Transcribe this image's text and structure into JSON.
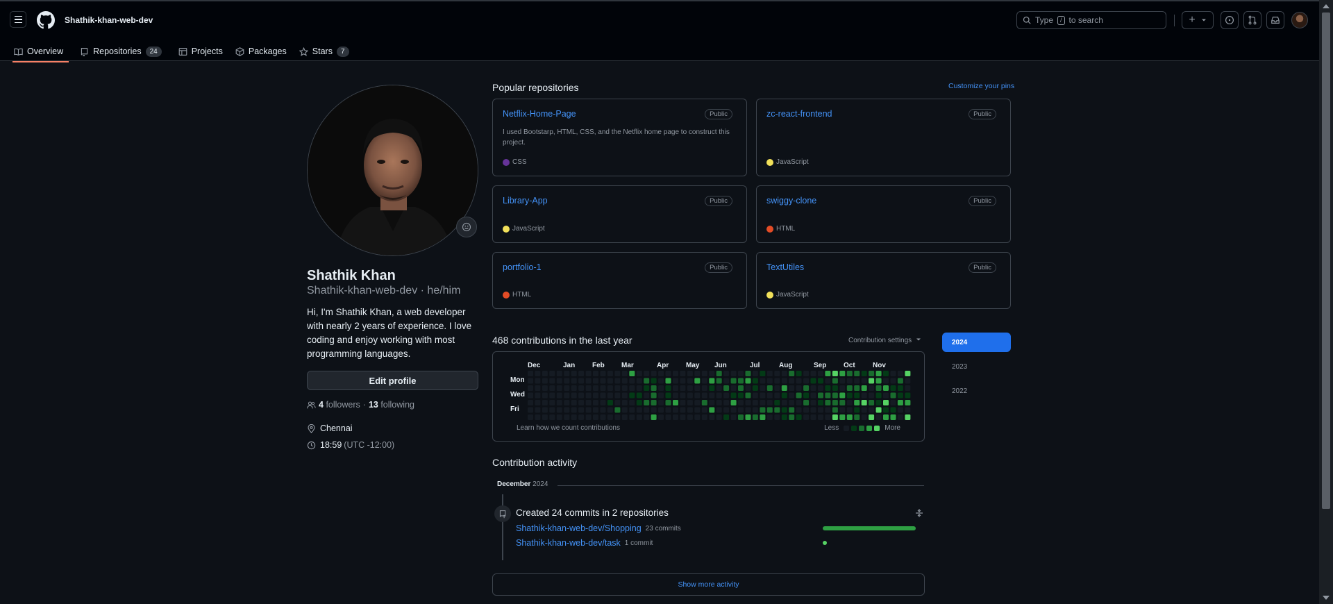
{
  "header": {
    "owner": "Shathik-khan-web-dev",
    "search_prefix": "Type",
    "search_key": "/",
    "search_suffix": "to search",
    "new_symbol": "+"
  },
  "tabs": [
    {
      "label": "Overview",
      "count": ""
    },
    {
      "label": "Repositories",
      "count": "24"
    },
    {
      "label": "Projects",
      "count": ""
    },
    {
      "label": "Packages",
      "count": ""
    },
    {
      "label": "Stars",
      "count": "7"
    }
  ],
  "profile": {
    "name": "Shathik Khan",
    "login_line": "Shathik-khan-web-dev · he/him",
    "bio": "Hi, I'm Shathik Khan, a web developer with nearly 2 years of experience. I love coding and enjoy working with most programming languages.",
    "edit_label": "Edit profile",
    "followers_count": "4",
    "followers_label": "followers",
    "separator": "·",
    "following_count": "13",
    "following_label": "following",
    "location": "Chennai",
    "time": "18:59",
    "timezone": "(UTC -12:00)"
  },
  "pinned": {
    "title": "Popular repositories",
    "customize_label": "Customize your pins",
    "repos": [
      {
        "name": "Netflix-Home-Page",
        "visibility": "Public",
        "description": "I used Bootstarp, HTML, CSS, and the Netflix home page to construct this project.",
        "language": "CSS",
        "lang_color": "#663399"
      },
      {
        "name": "zc-react-frontend",
        "visibility": "Public",
        "description": "",
        "language": "JavaScript",
        "lang_color": "#f1e05a"
      },
      {
        "name": "Library-App",
        "visibility": "Public",
        "description": "",
        "language": "JavaScript",
        "lang_color": "#f1e05a"
      },
      {
        "name": "swiggy-clone",
        "visibility": "Public",
        "description": "",
        "language": "HTML",
        "lang_color": "#e34c26"
      },
      {
        "name": "portfolio-1",
        "visibility": "Public",
        "description": "",
        "language": "HTML",
        "lang_color": "#e34c26"
      },
      {
        "name": "TextUtiles",
        "visibility": "Public",
        "description": "",
        "language": "JavaScript",
        "lang_color": "#f1e05a"
      }
    ]
  },
  "contributions": {
    "title": "468 contributions in the last year",
    "settings_label": "Contribution settings",
    "months": [
      "Dec",
      "Jan",
      "Feb",
      "Mar",
      "Apr",
      "May",
      "Jun",
      "Jul",
      "Aug",
      "Sep",
      "Oct",
      "Nov"
    ],
    "days": [
      "Mon",
      "Wed",
      "Fri"
    ],
    "learn_label": "Learn how we count contributions",
    "less_label": "Less",
    "more_label": "More",
    "level_colors": [
      "#151b23",
      "#033a16",
      "#196c2e",
      "#2ea043",
      "#56d364"
    ],
    "years": [
      "2024",
      "2023",
      "2022"
    ]
  },
  "activity": {
    "title": "Contribution activity",
    "month": "December",
    "year": "2024",
    "summary": "Created 24 commits in 2 repositories",
    "repos": [
      {
        "name": "Shathik-khan-web-dev/Shopping",
        "commits": "23 commits",
        "share": 0.958
      },
      {
        "name": "Shathik-khan-web-dev/task",
        "commits": "1 commit",
        "share": 0.042
      }
    ],
    "show_more_label": "Show more activity"
  }
}
